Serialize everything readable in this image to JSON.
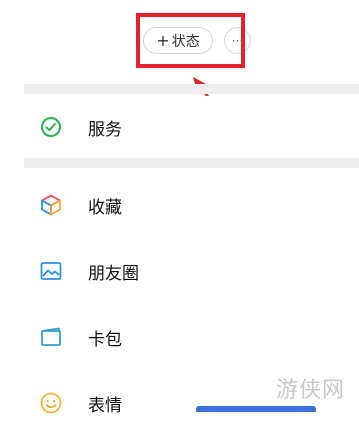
{
  "header": {
    "status_plus": "+",
    "status_label": "状态",
    "more_label": "···"
  },
  "menu": [
    {
      "label": "服务",
      "icon": "service-check-icon",
      "color": "#2bb24c"
    },
    {
      "label": "收藏",
      "icon": "favorites-cube-icon",
      "color": "#f2a33a"
    },
    {
      "label": "朋友圈",
      "icon": "moments-picture-icon",
      "color": "#2f8ee6"
    },
    {
      "label": "卡包",
      "icon": "wallet-card-icon",
      "color": "#2f9fd0"
    },
    {
      "label": "表情",
      "icon": "emoji-smile-icon",
      "color": "#f2b43a"
    }
  ],
  "watermark": "游侠网",
  "colors": {
    "highlight": "#e2242a",
    "gap": "#ededed"
  }
}
